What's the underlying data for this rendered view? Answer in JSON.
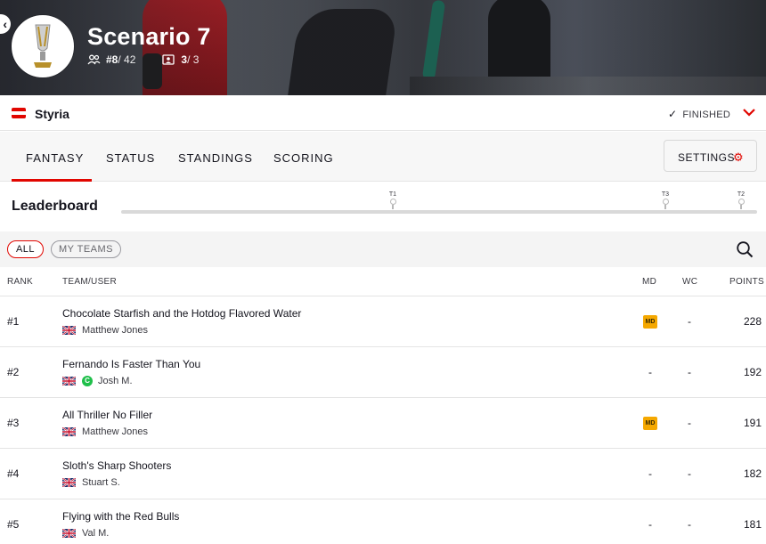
{
  "hero": {
    "back_icon": "chevron-left-icon",
    "title": "Scenario 7",
    "rank_label": "#8",
    "rank_total": " / 42",
    "teams_used": "3",
    "teams_total": " / 3"
  },
  "race": {
    "name": "Styria",
    "status": "FINISHED"
  },
  "tabs": [
    {
      "label": "FANTASY",
      "active": true
    },
    {
      "label": "STATUS"
    },
    {
      "label": "STANDINGS"
    },
    {
      "label": "SCORING"
    }
  ],
  "settings_label": "SETTINGS",
  "leaderboard": {
    "title": "Leaderboard",
    "markers": [
      "T1",
      "T3",
      "T2"
    ]
  },
  "filters": {
    "all": "ALL",
    "my_teams": "MY TEAMS"
  },
  "columns": {
    "rank": "RANK",
    "team": "TEAM/USER",
    "md": "MD",
    "wc": "WC",
    "points": "POINTS"
  },
  "rows": [
    {
      "rank": "#1",
      "team": "Chocolate Starfish and the Hotdog Flavored Water",
      "user": "Matthew Jones",
      "md": "MD",
      "wc": "-",
      "points": "228"
    },
    {
      "rank": "#2",
      "team": "Fernando Is Faster Than You",
      "user": "Josh M.",
      "badge": "C",
      "md": "-",
      "wc": "-",
      "points": "192"
    },
    {
      "rank": "#3",
      "team": "All Thriller No Filler",
      "user": "Matthew Jones",
      "md": "MD",
      "wc": "-",
      "points": "191"
    },
    {
      "rank": "#4",
      "team": "Sloth's Sharp Shooters",
      "user": "Stuart S.",
      "md": "-",
      "wc": "-",
      "points": "182"
    },
    {
      "rank": "#5",
      "team": "Flying with the Red Bulls",
      "user": "Val M.",
      "md": "-",
      "wc": "-",
      "points": "181"
    }
  ],
  "colors": {
    "accent": "#e10600",
    "md_chip": "#f5a800",
    "badge_green": "#1fbf4a"
  }
}
